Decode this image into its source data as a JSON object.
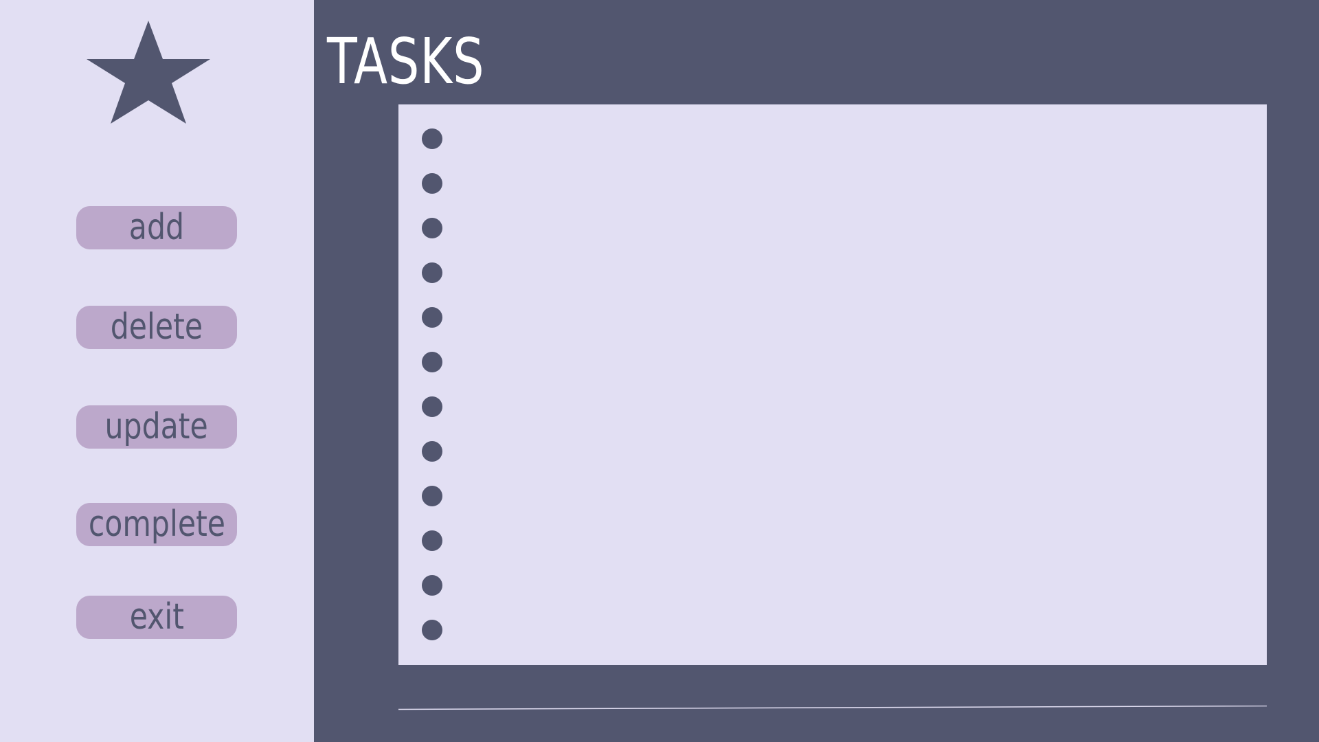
{
  "colors": {
    "sidebar_bg": "#e2dff3",
    "main_bg": "#52566f",
    "button_bg": "#bca8cb",
    "button_text": "#52566f",
    "title_text": "#ffffff",
    "panel_bg": "#e2dff3",
    "bullet": "#52566f"
  },
  "logo": {
    "icon": "star-icon"
  },
  "sidebar": {
    "buttons": [
      {
        "label": "add"
      },
      {
        "label": "delete"
      },
      {
        "label": "update"
      },
      {
        "label": "complete"
      },
      {
        "label": "exit"
      }
    ]
  },
  "main": {
    "title": "TASKS",
    "tasks": [
      {
        "text": ""
      },
      {
        "text": ""
      },
      {
        "text": ""
      },
      {
        "text": ""
      },
      {
        "text": ""
      },
      {
        "text": ""
      },
      {
        "text": ""
      },
      {
        "text": ""
      },
      {
        "text": ""
      },
      {
        "text": ""
      },
      {
        "text": ""
      },
      {
        "text": ""
      }
    ],
    "input": {
      "value": "",
      "placeholder": ""
    }
  }
}
